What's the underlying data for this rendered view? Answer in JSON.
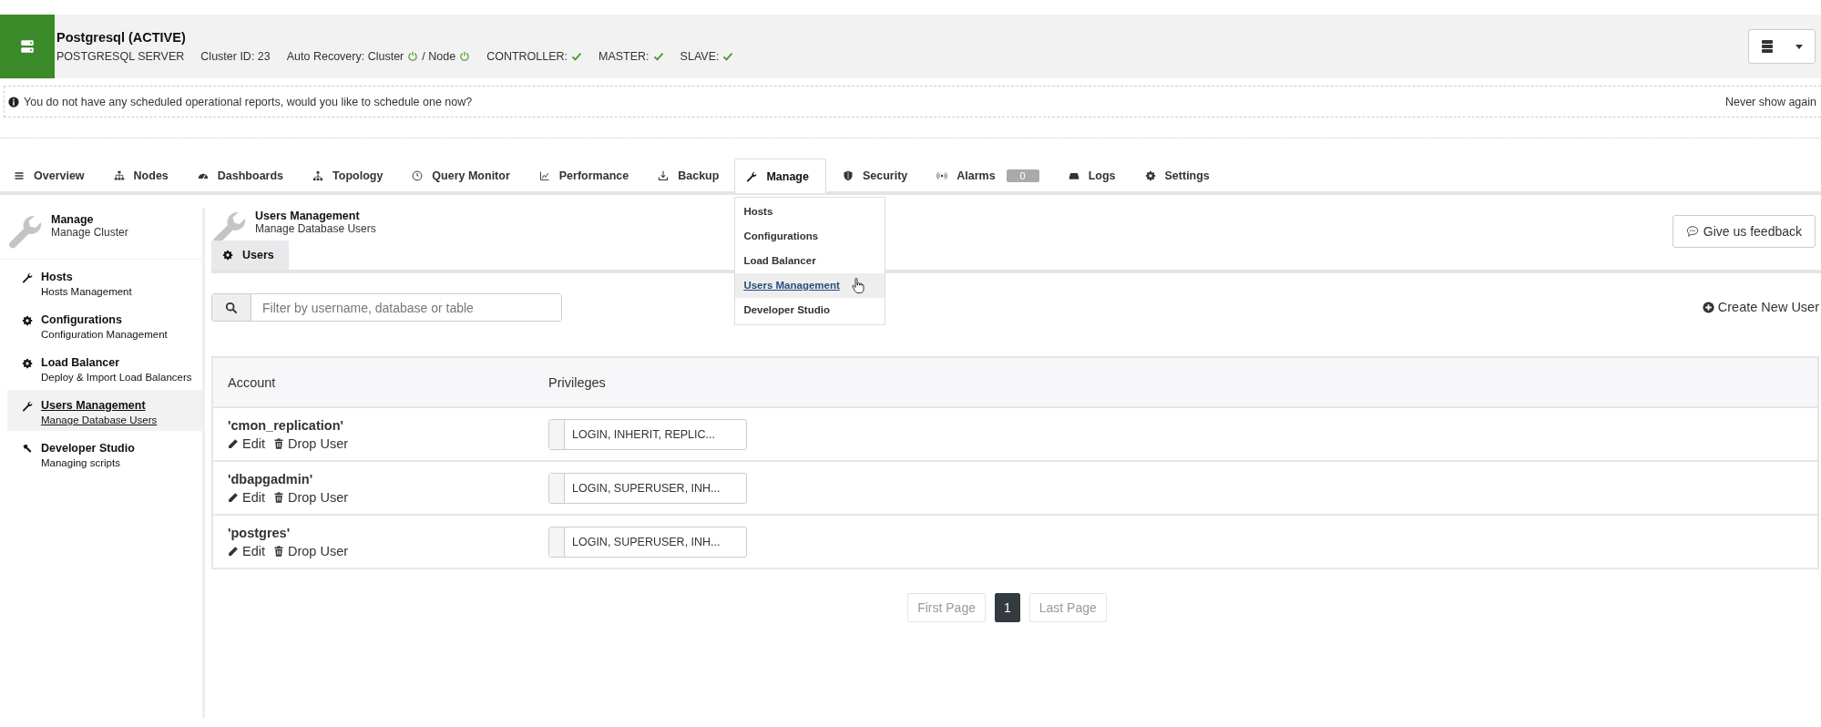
{
  "cluster": {
    "title": "Postgresql (ACTIVE)",
    "meta": [
      {
        "kind": "text",
        "text": "POSTGRESQL SERVER"
      },
      {
        "kind": "text",
        "text": "Cluster ID: 23"
      },
      {
        "kind": "recovery",
        "label": "Auto Recovery: Cluster",
        "node_label": "/ Node",
        "cluster_on": true,
        "node_on": true
      },
      {
        "kind": "check",
        "label": "CONTROLLER:",
        "ok": true
      },
      {
        "kind": "check",
        "label": "MASTER:",
        "ok": true
      },
      {
        "kind": "check",
        "label": "SLAVE:",
        "ok": true
      }
    ]
  },
  "notice": {
    "text": "You do not have any scheduled operational reports, would you like to schedule one now?",
    "dismiss": "Never show again"
  },
  "tabs": [
    {
      "label": "Overview",
      "selected": false
    },
    {
      "label": "Nodes",
      "selected": false
    },
    {
      "label": "Dashboards",
      "selected": false
    },
    {
      "label": "Topology",
      "selected": false
    },
    {
      "label": "Query Monitor",
      "selected": false
    },
    {
      "label": "Performance",
      "selected": false
    },
    {
      "label": "Backup",
      "selected": false
    },
    {
      "label": "Manage",
      "selected": true
    },
    {
      "label": "Security",
      "selected": false
    },
    {
      "label": "Alarms",
      "selected": false,
      "badge": "0"
    },
    {
      "label": "Logs",
      "selected": false
    },
    {
      "label": "Settings",
      "selected": false
    }
  ],
  "manage_menu": {
    "items": [
      {
        "label": "Hosts",
        "hovered": false
      },
      {
        "label": "Configurations",
        "hovered": false
      },
      {
        "label": "Load Balancer",
        "hovered": false
      },
      {
        "label": "Users Management",
        "hovered": true
      },
      {
        "label": "Developer Studio",
        "hovered": false
      }
    ]
  },
  "sidebar": {
    "title": "Manage",
    "subtitle": "Manage Cluster",
    "items": [
      {
        "title": "Hosts",
        "subtitle": "Hosts Management",
        "selected": false
      },
      {
        "title": "Configurations",
        "subtitle": "Configuration Management",
        "selected": false
      },
      {
        "title": "Load Balancer",
        "subtitle": "Deploy & Import Load Balancers",
        "selected": false
      },
      {
        "title": "Users Management",
        "subtitle": "Manage Database Users",
        "selected": true
      },
      {
        "title": "Developer Studio",
        "subtitle": "Managing scripts",
        "selected": false
      }
    ]
  },
  "page": {
    "title": "Users Management",
    "subtitle": "Manage Database Users",
    "feedback": "Give us feedback",
    "subtabs": [
      {
        "label": "Users",
        "selected": true
      }
    ],
    "search": {
      "placeholder": "Filter by username, database or table"
    },
    "create": "Create New User",
    "table": {
      "columns": [
        "Account",
        "Privileges"
      ],
      "rows": [
        {
          "account": "'cmon_replication'",
          "edit": "Edit",
          "drop": "Drop User",
          "privileges": "LOGIN, INHERIT, REPLIC..."
        },
        {
          "account": "'dbapgadmin'",
          "edit": "Edit",
          "drop": "Drop User",
          "privileges": "LOGIN, SUPERUSER, INH..."
        },
        {
          "account": "'postgres'",
          "edit": "Edit",
          "drop": "Drop User",
          "privileges": "LOGIN, SUPERUSER, INH..."
        }
      ]
    },
    "pagination": {
      "first": "First Page",
      "pages": [
        {
          "label": "1",
          "selected": true
        }
      ],
      "last": "Last Page"
    }
  }
}
